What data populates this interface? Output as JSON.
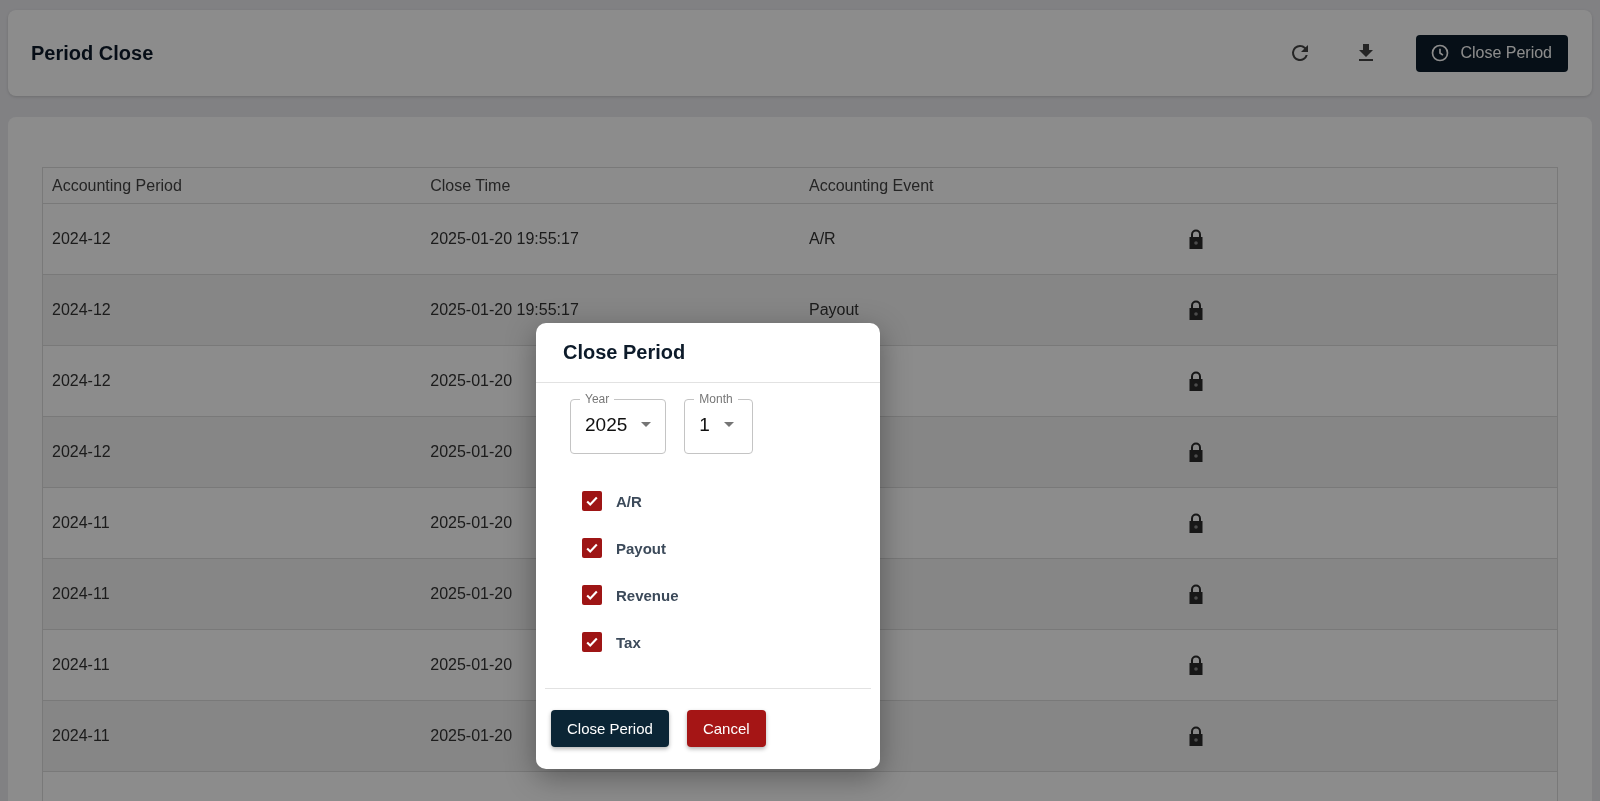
{
  "header": {
    "title": "Period Close",
    "close_button": "Close Period"
  },
  "table": {
    "columns": [
      "Accounting Period",
      "Close Time",
      "Accounting Event"
    ],
    "rows": [
      {
        "period": "2024-12",
        "close_time": "2025-01-20 19:55:17",
        "event": "A/R"
      },
      {
        "period": "2024-12",
        "close_time": "2025-01-20 19:55:17",
        "event": "Payout"
      },
      {
        "period": "2024-12",
        "close_time": "2025-01-20"
      },
      {
        "period": "2024-12",
        "close_time": "2025-01-20"
      },
      {
        "period": "2024-11",
        "close_time": "2025-01-20"
      },
      {
        "period": "2024-11",
        "close_time": "2025-01-20"
      },
      {
        "period": "2024-11",
        "close_time": "2025-01-20"
      },
      {
        "period": "2024-11",
        "close_time": "2025-01-20"
      }
    ]
  },
  "dialog": {
    "title": "Close Period",
    "selects": [
      {
        "label": "Year",
        "value": "2025"
      },
      {
        "label": "Month",
        "value": "1"
      }
    ],
    "events": [
      {
        "label": "A/R",
        "checked": true
      },
      {
        "label": "Payout",
        "checked": true
      },
      {
        "label": "Revenue",
        "checked": true
      },
      {
        "label": "Tax",
        "checked": true
      }
    ],
    "confirm": "Close Period",
    "cancel": "Cancel"
  }
}
